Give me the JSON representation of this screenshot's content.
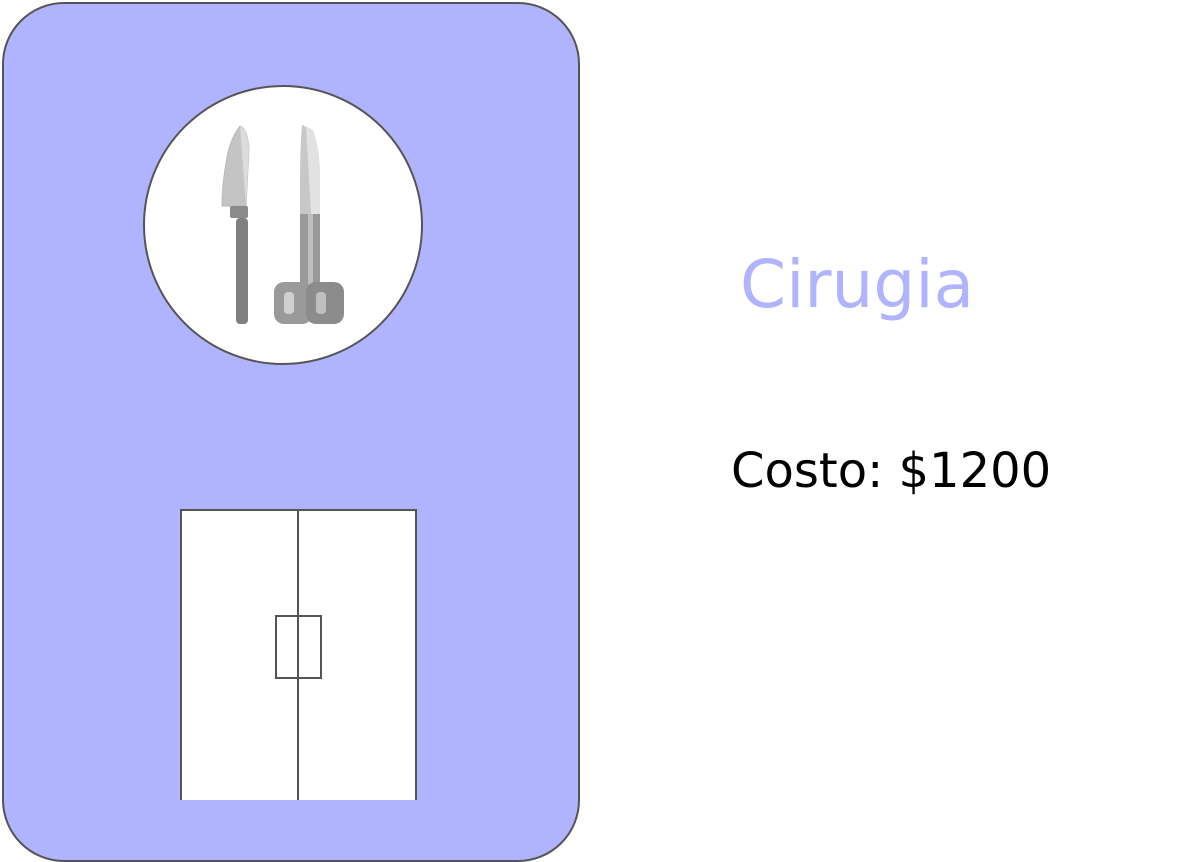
{
  "service": {
    "title": "Cirugia",
    "cost_label": "Costo: $1200"
  },
  "colors": {
    "card_background": "#b0b4ff",
    "title": "#b0b4ff",
    "cost": "#000000",
    "outline": "#555555"
  },
  "icons": {
    "medallion": [
      "scalpel-icon",
      "scissors-icon"
    ],
    "door": "double-door-icon"
  }
}
